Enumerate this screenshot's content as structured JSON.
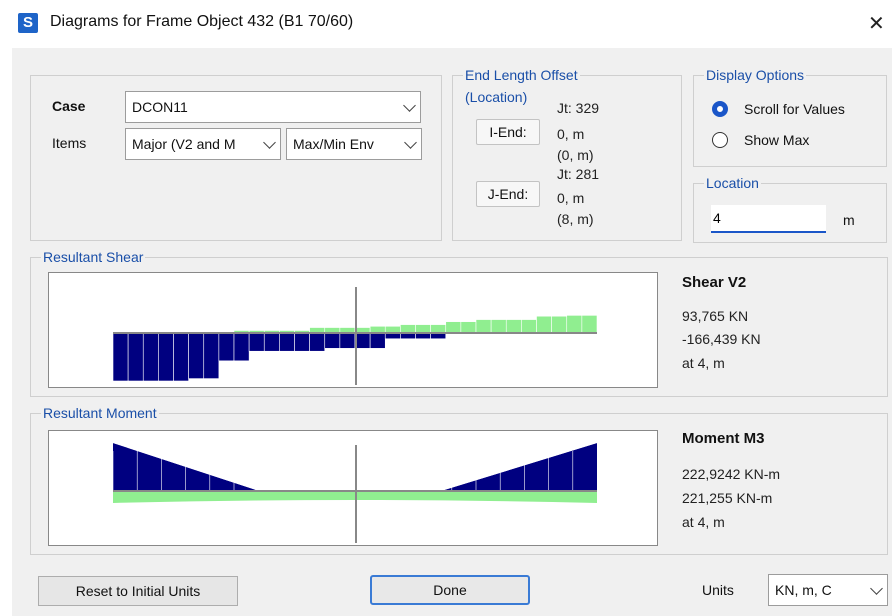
{
  "window": {
    "app_icon_letter": "S",
    "title": "Diagrams for Frame Object 432  (B1 70/60)",
    "close_glyph": "✕"
  },
  "case_group": {
    "case_label": "Case",
    "case_value": "DCON11",
    "items_label": "Items",
    "items_value": "Major (V2 and M",
    "env_value": "Max/Min Env"
  },
  "end_offset": {
    "legend_line1": "End Length Offset",
    "legend_line2": "(Location)",
    "i_end_button": "I-End:",
    "i_jt": "Jt:  329",
    "i_offset": "0, m",
    "i_location": "(0, m)",
    "j_end_button": "J-End:",
    "j_jt": "Jt:  281",
    "j_offset": "0, m",
    "j_location": "(8, m)"
  },
  "display_options": {
    "legend": "Display Options",
    "option_scroll": "Scroll for Values",
    "option_show_max": "Show Max",
    "selected": "scroll"
  },
  "location": {
    "legend": "Location",
    "value": "4",
    "unit": "m"
  },
  "shear": {
    "legend": "Resultant Shear",
    "heading": "Shear V2",
    "value_max": "93,765 KN",
    "value_min": "-166,439 KN",
    "at": "at 4, m",
    "colors": {
      "positive": "#90ee90",
      "negative": "#000080"
    },
    "max_fraction": [
      0.0,
      0.0,
      0.0,
      0.0,
      0.0,
      0.0,
      0.0,
      0.0,
      0.06,
      0.06,
      0.06,
      0.06,
      0.06,
      0.13,
      0.13,
      0.13,
      0.13,
      0.16,
      0.16,
      0.2,
      0.2,
      0.2,
      0.27,
      0.27,
      0.32,
      0.32,
      0.32,
      0.32,
      0.4,
      0.4,
      0.42,
      0.42
    ],
    "min_fraction": [
      1.0,
      1.0,
      1.0,
      1.0,
      1.0,
      0.95,
      0.95,
      0.58,
      0.58,
      0.38,
      0.38,
      0.38,
      0.38,
      0.38,
      0.32,
      0.32,
      0.32,
      0.32,
      0.12,
      0.12,
      0.12,
      0.12,
      0.0,
      0.0,
      0.0,
      0.0,
      0.0,
      0.0,
      0.0,
      0.0,
      0.0,
      0.0
    ]
  },
  "moment": {
    "legend": "Resultant Moment",
    "heading": "Moment M3",
    "value_max": "222,9242 KN-m",
    "value_min": "221,255 KN-m",
    "at": "at 4, m",
    "colors": {
      "positive": "#90ee90",
      "negative": "#000080"
    }
  },
  "buttons": {
    "reset": "Reset to Initial Units",
    "done": "Done"
  },
  "units": {
    "label": "Units",
    "value": "KN, m, C"
  }
}
